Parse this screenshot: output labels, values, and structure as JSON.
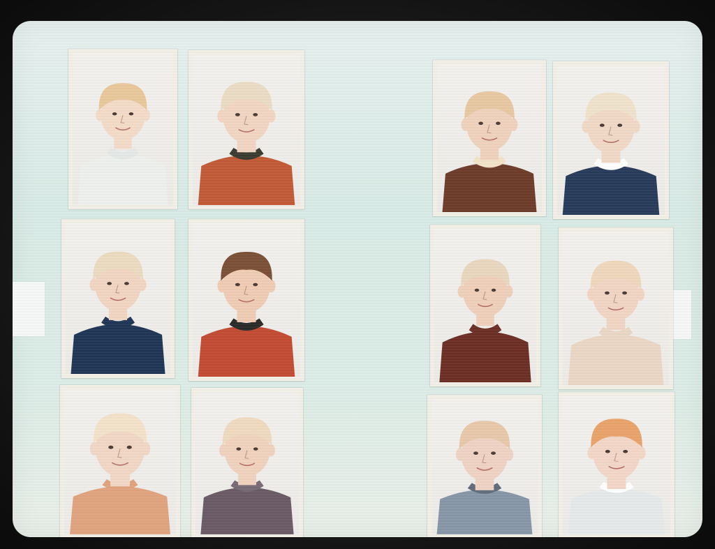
{
  "image": {
    "description_type": "scanned page of a school class photo album",
    "photos": [
      {
        "id": "p1",
        "row": 1,
        "col": 1,
        "hair": "#e8c79a",
        "skin": "#f3dcc8",
        "shirt": "#eef0ee",
        "collar": "#e4e8e7"
      },
      {
        "id": "p2",
        "row": 1,
        "col": 2,
        "hair": "#eadcc4",
        "skin": "#f1d6c2",
        "shirt": "#c25a35",
        "collar": "#3a3a30"
      },
      {
        "id": "p3",
        "row": 1,
        "col": 3,
        "hair": "#e8c8a2",
        "skin": "#efd2bd",
        "shirt": "#6d3b2a",
        "collar": "#f2e2c8"
      },
      {
        "id": "p4",
        "row": 1,
        "col": 4,
        "hair": "#f0e2cc",
        "skin": "#f1d8c6",
        "shirt": "#273a5a",
        "collar": "#ffffff"
      },
      {
        "id": "p5",
        "row": 2,
        "col": 1,
        "hair": "#eadbc0",
        "skin": "#f1d6c2",
        "shirt": "#1f3555",
        "collar": "#1f3555"
      },
      {
        "id": "p6",
        "row": 2,
        "col": 2,
        "hair": "#7a4f35",
        "skin": "#efccb4",
        "shirt": "#c24b33",
        "collar": "#2a2a28"
      },
      {
        "id": "p7",
        "row": 2,
        "col": 3,
        "hair": "#e9d7bf",
        "skin": "#efcfba",
        "shirt": "#6b2e25",
        "collar": "#6b2e25"
      },
      {
        "id": "p8",
        "row": 2,
        "col": 4,
        "hair": "#efd7bb",
        "skin": "#f1d5c4",
        "shirt": "#ead6c4",
        "collar": "#ead6c4"
      },
      {
        "id": "p9",
        "row": 3,
        "col": 1,
        "hair": "#f4e2ca",
        "skin": "#f1d7c5",
        "shirt": "#e0a37e",
        "collar": "#e0a37e"
      },
      {
        "id": "p10",
        "row": 3,
        "col": 2,
        "hair": "#efdac0",
        "skin": "#f0d2be",
        "shirt": "#6a5a66",
        "collar": "#776a74"
      },
      {
        "id": "p11",
        "row": 3,
        "col": 3,
        "hair": "#e8c8aa",
        "skin": "#efd2c3",
        "shirt": "#8796a6",
        "collar": "#5f6c79"
      },
      {
        "id": "p12",
        "row": 3,
        "col": 4,
        "hair": "#e9a36a",
        "skin": "#f3d7c8",
        "shirt": "#e5e9ea",
        "collar": "#ffffff"
      }
    ]
  }
}
